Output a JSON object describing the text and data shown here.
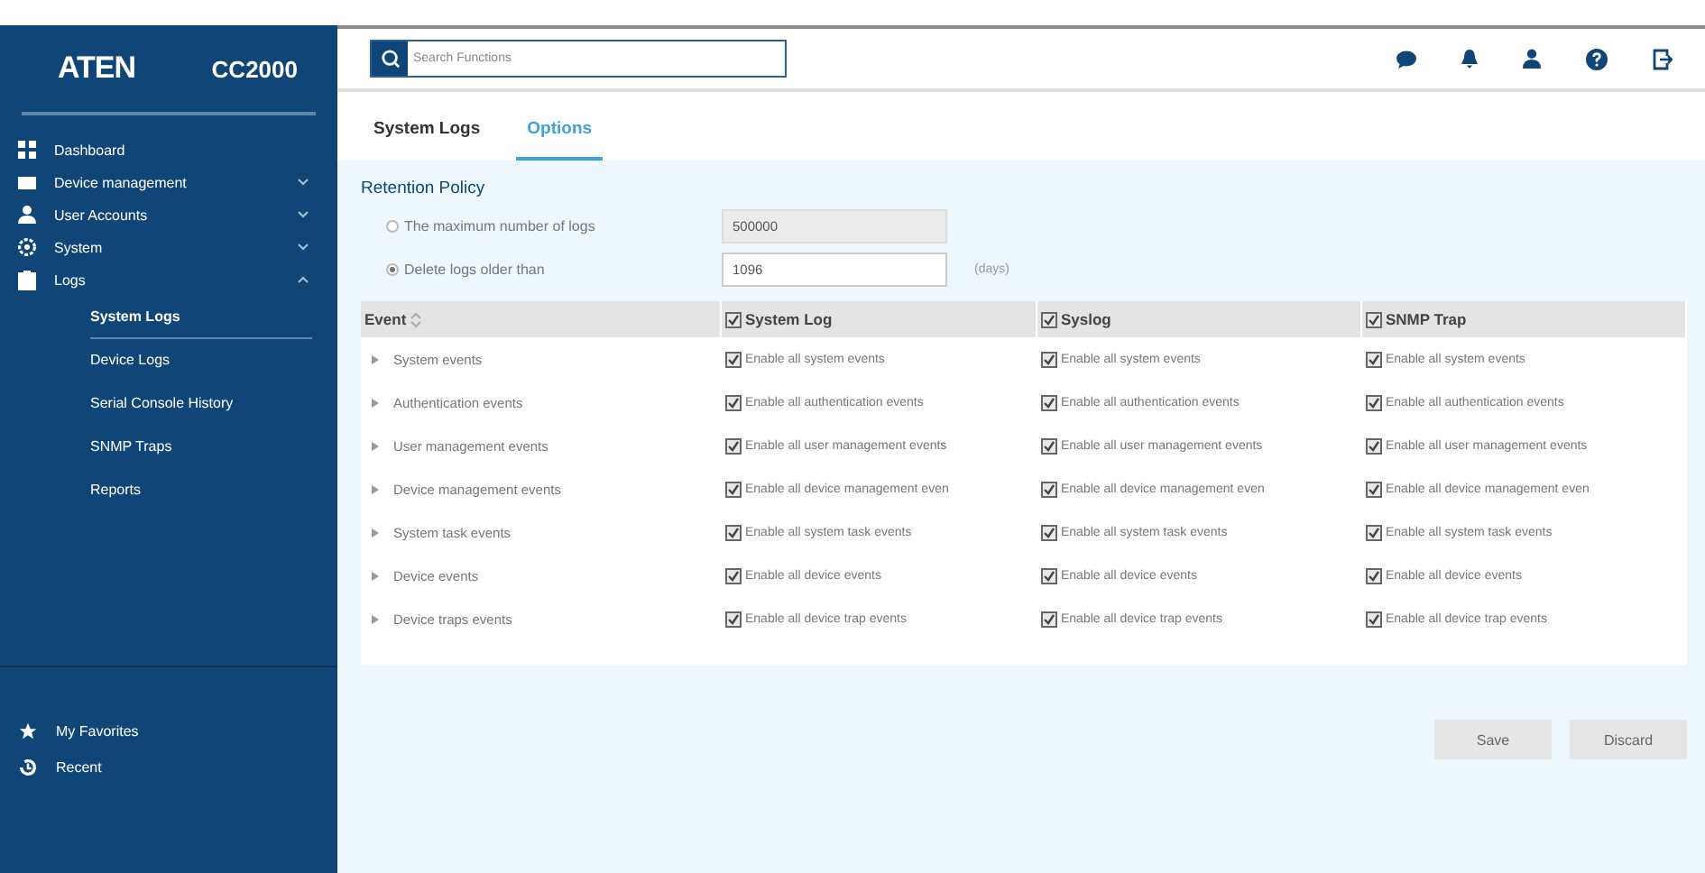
{
  "brand": {
    "logo": "ATEN",
    "model": "CC2000"
  },
  "sidebar": {
    "items": [
      {
        "label": "Dashboard"
      },
      {
        "label": "Device management",
        "expanded": false
      },
      {
        "label": "User Accounts",
        "expanded": false
      },
      {
        "label": "System",
        "expanded": false
      },
      {
        "label": "Logs",
        "expanded": true,
        "children": [
          {
            "label": "System Logs",
            "selected": true
          },
          {
            "label": "Device Logs",
            "selected": false
          },
          {
            "label": "Serial Console History",
            "selected": false
          },
          {
            "label": "SNMP Traps",
            "selected": false
          },
          {
            "label": "Reports",
            "selected": false
          }
        ]
      }
    ],
    "bottom": [
      {
        "label": "My Favorites"
      },
      {
        "label": "Recent"
      }
    ]
  },
  "search": {
    "placeholder": "Search Functions"
  },
  "tabs": [
    {
      "label": "System Logs",
      "selected": false
    },
    {
      "label": "Options",
      "selected": true
    }
  ],
  "retention": {
    "title": "Retention Policy",
    "options": [
      {
        "label": "The maximum number of logs",
        "selected": false,
        "value": "500000",
        "disabled": true
      },
      {
        "label": "Delete logs older than",
        "selected": true,
        "value": "1096",
        "disabled": false,
        "unit": "(days)"
      }
    ]
  },
  "table": {
    "columns": [
      {
        "label": "Event",
        "kind": "sort"
      },
      {
        "label": "System Log",
        "kind": "check",
        "checked": true
      },
      {
        "label": "Syslog",
        "kind": "check",
        "checked": true
      },
      {
        "label": "SNMP Trap",
        "kind": "check",
        "checked": true
      }
    ],
    "rows": [
      {
        "cells": [
          {
            "label": "System events"
          },
          {
            "label": "Enable all system events",
            "checked": true
          },
          {
            "label": "Enable all system events",
            "checked": true
          },
          {
            "label": "Enable all system events",
            "checked": true
          }
        ]
      },
      {
        "cells": [
          {
            "label": "Authentication events"
          },
          {
            "label": "Enable all authentication events",
            "checked": true
          },
          {
            "label": "Enable all authentication events",
            "checked": true
          },
          {
            "label": "Enable all authentication events",
            "checked": true
          }
        ]
      },
      {
        "cells": [
          {
            "label": "User management events"
          },
          {
            "label": "Enable all user management events",
            "checked": true
          },
          {
            "label": "Enable all user management events",
            "checked": true
          },
          {
            "label": "Enable all user management events",
            "checked": true
          }
        ]
      },
      {
        "cells": [
          {
            "label": "Device management events"
          },
          {
            "label": "Enable all device management even",
            "checked": true
          },
          {
            "label": "Enable all device management even",
            "checked": true
          },
          {
            "label": "Enable all device management even",
            "checked": true
          }
        ]
      },
      {
        "cells": [
          {
            "label": "System task events"
          },
          {
            "label": "Enable all system task events",
            "checked": true
          },
          {
            "label": "Enable all system task events",
            "checked": true
          },
          {
            "label": "Enable all system task events",
            "checked": true
          }
        ]
      },
      {
        "cells": [
          {
            "label": "Device events"
          },
          {
            "label": "Enable all device events",
            "checked": true
          },
          {
            "label": "Enable all device events",
            "checked": true
          },
          {
            "label": "Enable all device events",
            "checked": true
          }
        ]
      },
      {
        "cells": [
          {
            "label": "Device traps events"
          },
          {
            "label": "Enable all device trap events",
            "checked": true
          },
          {
            "label": "Enable all device trap events",
            "checked": true
          },
          {
            "label": "Enable all device trap events",
            "checked": true
          }
        ]
      }
    ]
  },
  "buttons": [
    {
      "label": "Save"
    },
    {
      "label": "Discard"
    }
  ]
}
